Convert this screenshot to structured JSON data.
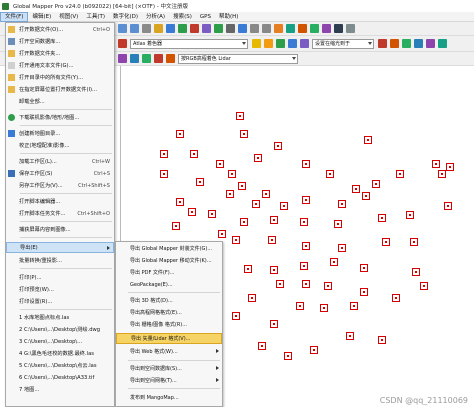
{
  "window": {
    "title": "Global Mapper Pro v24.0 (b092022) [64-bit] (×OTF) - 中文注册版"
  },
  "menubar": [
    "文件(F)",
    "编辑(E)",
    "视图(V)",
    "工具(T)",
    "数字化(D)",
    "分析(A)",
    "搜索(S)",
    "GPS",
    "帮助(H)"
  ],
  "toolbar": {
    "layer_combo": "Atlas 着色器",
    "settings_combo": "设置在缩光到于",
    "shader_combo": "按RGB高程着色 Lidar"
  },
  "file_menu": [
    {
      "label": "打开数据文件(O)...",
      "shortcut": "Ctrl+O",
      "icon": "folder-open-icon"
    },
    {
      "label": "打开空间数据库...",
      "shortcut": "",
      "icon": "database-icon"
    },
    {
      "label": "打开数据文件夹...",
      "shortcut": "",
      "icon": "folder-icon"
    },
    {
      "label": "打开通用文本文件(G)...",
      "shortcut": "",
      "icon": "text-file-icon"
    },
    {
      "label": "打开目录中的所有文件(Y)...",
      "shortcut": "",
      "icon": "folder-icon"
    },
    {
      "label": "在指定屏幕位置打开数据文件(I)...",
      "shortcut": "",
      "icon": "folder-icon"
    },
    {
      "label": "卸载全部...",
      "shortcut": "",
      "icon": "unload-icon"
    },
    {
      "label": "下载联机影像/地形/地图...",
      "shortcut": "",
      "icon": "globe-icon"
    },
    {
      "label": "创建新地图目录...",
      "shortcut": "",
      "icon": "catalog-icon"
    },
    {
      "label": "校正(地理配准)影像...",
      "shortcut": "",
      "icon": "rectify-icon"
    },
    {
      "label": "加载工作区(L)...",
      "shortcut": "Ctrl+W",
      "icon": "workspace-icon"
    },
    {
      "label": "保存工作区(S)",
      "shortcut": "Ctrl+S",
      "icon": "save-icon"
    },
    {
      "label": "另存工作区为(V)...",
      "shortcut": "Ctrl+Shift+S",
      "icon": "save-as-icon"
    },
    {
      "label": "打开脚本编辑器...",
      "shortcut": "",
      "icon": "script-icon"
    },
    {
      "label": "打开脚本任务文件...",
      "shortcut": "Ctrl+Shift+O",
      "icon": "script-icon"
    },
    {
      "label": "捕获屏幕内容到图像...",
      "shortcut": "",
      "icon": "camera-icon"
    },
    {
      "label": "导出(E)",
      "shortcut": "",
      "icon": "export-icon"
    },
    {
      "label": "批量转换/重投影...",
      "shortcut": "",
      "icon": "batch-icon"
    },
    {
      "label": "打印(P)...",
      "shortcut": "",
      "icon": "print-icon"
    },
    {
      "label": "打印预览(W)...",
      "shortcut": "",
      "icon": "print-preview-icon"
    },
    {
      "label": "打印设置(R)...",
      "shortcut": "",
      "icon": "print-setup-icon"
    },
    {
      "label": "1 水库地图点标点.las",
      "shortcut": "",
      "icon": ""
    },
    {
      "label": "2 C:\\Users\\...\\Desktop\\测绘.dwg",
      "shortcut": "",
      "icon": ""
    },
    {
      "label": "3 C:\\Users\\...\\Desktop\\...",
      "shortcut": "",
      "icon": ""
    },
    {
      "label": "4 G:\\黑色毛坯校的数据.最终.las",
      "shortcut": "",
      "icon": ""
    },
    {
      "label": "5 C:\\Users\\...\\Desktop\\点云.las",
      "shortcut": "",
      "icon": ""
    },
    {
      "label": "6 C:\\Users\\...\\Desktop\\A33.tif",
      "shortcut": "",
      "icon": ""
    },
    {
      "label": "7 地图...",
      "shortcut": "",
      "icon": ""
    }
  ],
  "export_submenu": [
    "导出 Global Mapper 封装文件(G)...",
    "导出 Global Mapper 移动文件(K)...",
    "导出 PDF 文件(F)...",
    "GeoPackage(E)...",
    "导出 3D 格式(D)...",
    "导出高程网格格式(E)...",
    "导出 栅格/图像 格式(R)...",
    "导出 矢量/Lidar 格式(V)...",
    "导出 Web 格式(W)...",
    "导出到空间数据库(S)...",
    "导出到空间网格(T)...",
    "发布到 MangoMap..."
  ],
  "watermark": "CSDN @qq_21110069"
}
